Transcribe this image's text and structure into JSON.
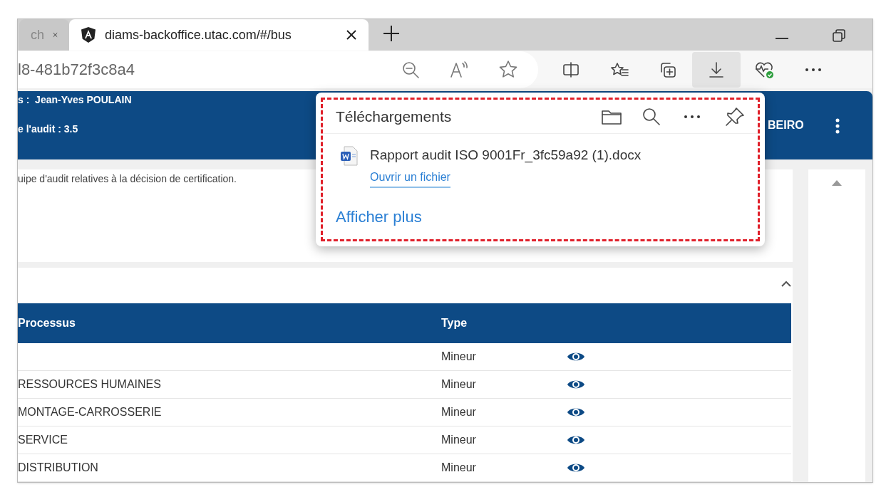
{
  "tabs": [
    {
      "title": "ch",
      "selected": false
    },
    {
      "title": "diams-backoffice.utac.com/#/bus",
      "selected": true
    }
  ],
  "address": {
    "value": "l8-481b72f3c8a4"
  },
  "toolbar": [
    {
      "kind": "split",
      "selected": false
    },
    {
      "kind": "favorites",
      "selected": false
    },
    {
      "kind": "collections",
      "selected": false
    },
    {
      "kind": "download",
      "selected": true
    },
    {
      "kind": "health",
      "selected": false
    },
    {
      "kind": "more",
      "selected": false
    }
  ],
  "header": {
    "lines": [
      "s :  Jean-Yves POULAIN",
      "e l'audit : 3.5"
    ],
    "user": "BEIRO"
  },
  "note": "uipe d'audit relatives à la décision de certification.",
  "table": {
    "columns": [
      "Processus",
      "Type"
    ],
    "rows": [
      {
        "process": "",
        "type": "Mineur"
      },
      {
        "process": "RESSOURCES HUMAINES",
        "type": "Mineur"
      },
      {
        "process": "MONTAGE-CARROSSERIE",
        "type": "Mineur"
      },
      {
        "process": "SERVICE",
        "type": "Mineur"
      },
      {
        "process": "DISTRIBUTION",
        "type": "Mineur"
      }
    ]
  },
  "downloads": {
    "title": "Téléchargements",
    "items": [
      {
        "file": "Rapport audit ISO 9001Fr_3fc59a92 (1).docx",
        "action": "Ouvrir un fichier"
      }
    ],
    "more": "Afficher plus"
  }
}
